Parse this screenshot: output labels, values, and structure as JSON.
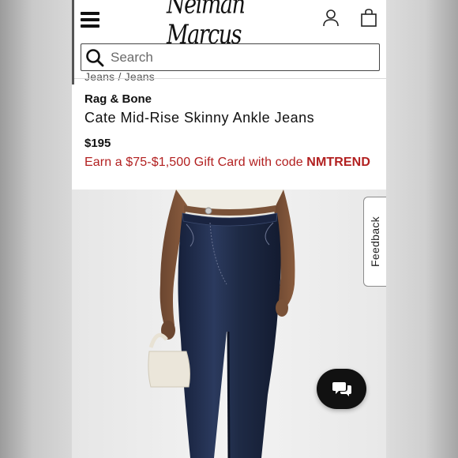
{
  "header": {
    "logo_text": "Neiman Marcus",
    "menu_icon": "hamburger-menu-icon",
    "account_icon": "user-account-icon",
    "bag_icon": "shopping-bag-icon"
  },
  "search": {
    "placeholder": "Search",
    "icon": "search-icon"
  },
  "product": {
    "breadcrumb": "Jeans / Jeans",
    "brand": "Rag & Bone",
    "title": "Cate Mid-Rise Skinny Ankle Jeans",
    "price": "$195",
    "promo_text": "Earn a $75-$1,500 Gift Card with code ",
    "promo_code": "NMTREND"
  },
  "feedback": {
    "label": "Feedback"
  },
  "chat": {
    "icon": "chat-bubbles-icon"
  },
  "colors": {
    "promo_red": "#b22020",
    "denim": "#1e2a45",
    "chat_button": "#111111"
  }
}
